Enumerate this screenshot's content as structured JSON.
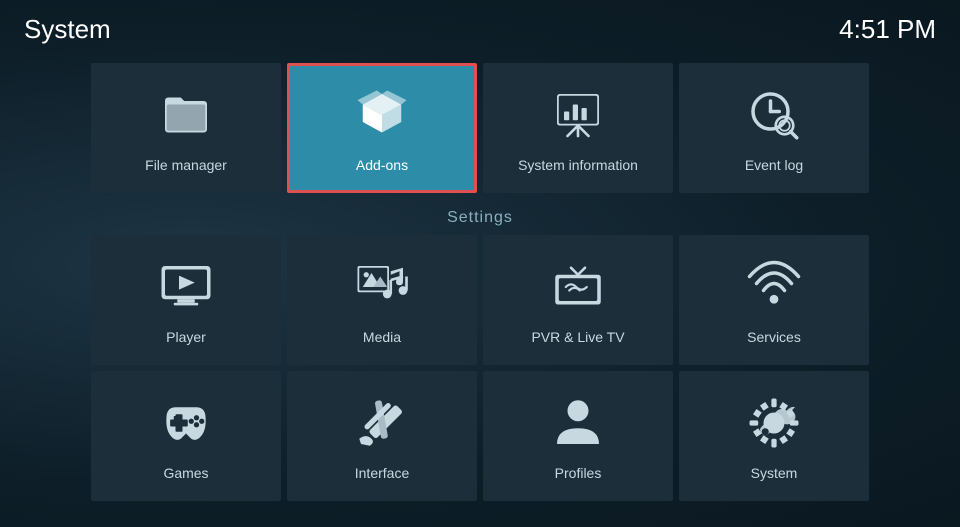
{
  "header": {
    "title": "System",
    "time": "4:51 PM"
  },
  "top_tiles": [
    {
      "id": "file-manager",
      "label": "File manager",
      "active": false
    },
    {
      "id": "add-ons",
      "label": "Add-ons",
      "active": true
    },
    {
      "id": "system-information",
      "label": "System information",
      "active": false
    },
    {
      "id": "event-log",
      "label": "Event log",
      "active": false
    }
  ],
  "settings_label": "Settings",
  "settings_tiles": [
    {
      "id": "player",
      "label": "Player"
    },
    {
      "id": "media",
      "label": "Media"
    },
    {
      "id": "pvr-live-tv",
      "label": "PVR & Live TV"
    },
    {
      "id": "services",
      "label": "Services"
    },
    {
      "id": "games",
      "label": "Games"
    },
    {
      "id": "interface",
      "label": "Interface"
    },
    {
      "id": "profiles",
      "label": "Profiles"
    },
    {
      "id": "system",
      "label": "System"
    }
  ]
}
